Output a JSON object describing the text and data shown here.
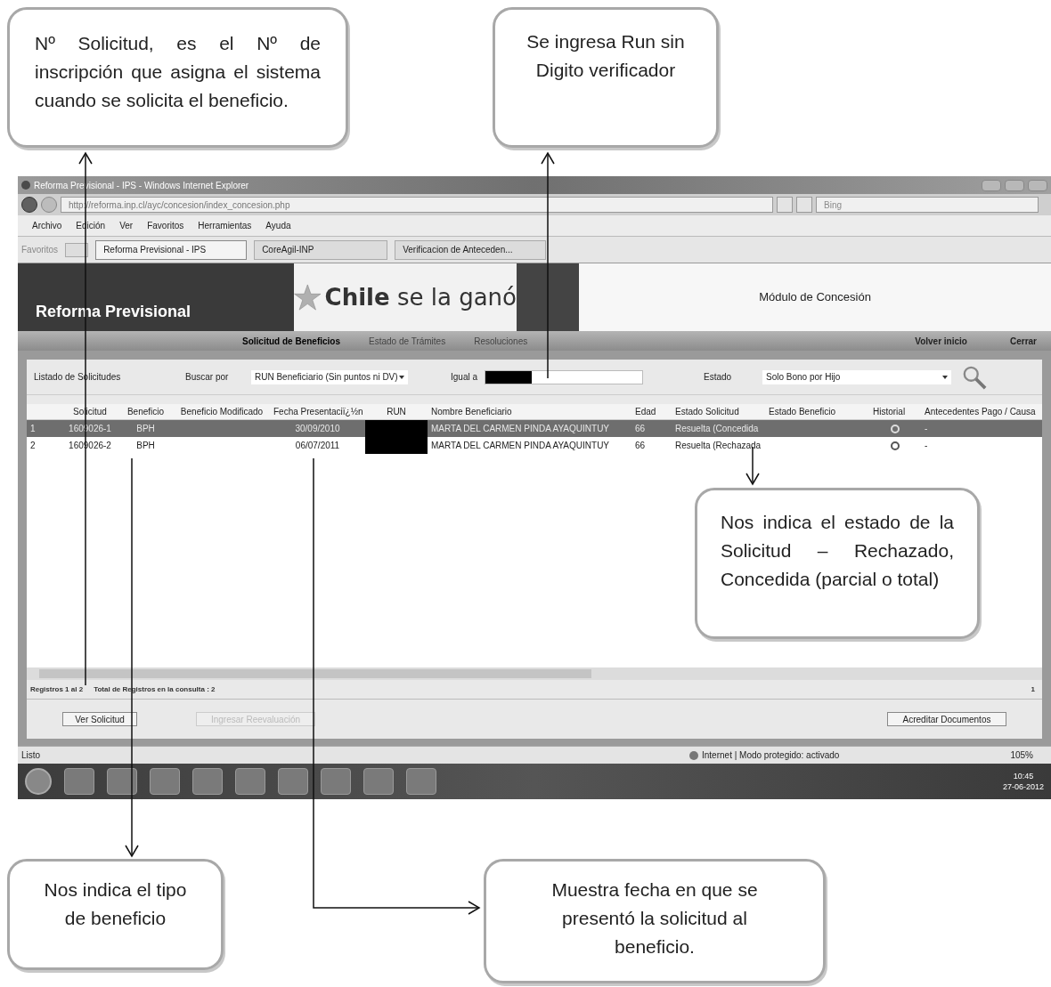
{
  "callouts": [
    {
      "text": "Nº Solicitud, es el Nº de inscripción que asigna el sistema cuando se solicita el beneficio."
    },
    {
      "text": "Se ingresa Run sin Digito verificador"
    },
    {
      "text": "Nos indica el estado de la Solicitud – Rechazado, Concedida (parcial o total)"
    },
    {
      "text": "Nos indica el tipo de beneficio"
    },
    {
      "text": "Muestra fecha en que se presentó la solicitud al beneficio."
    }
  ],
  "window": {
    "title": "Reforma Previsional - IPS - Windows Internet Explorer",
    "address": "http://reforma.inp.cl/ayc/concesion/index_concesion.php",
    "search_placeholder": "Bing",
    "menu": [
      "Archivo",
      "Edición",
      "Ver",
      "Favoritos",
      "Herramientas",
      "Ayuda"
    ],
    "favorites": "Favoritos",
    "tabs": [
      {
        "label": "Reforma Previsional - IPS",
        "selected": true
      },
      {
        "label": "CoreAgil-INP",
        "selected": false
      },
      {
        "label": "Verificacion de Anteceden...",
        "selected": false
      }
    ]
  },
  "banner": {
    "left": "Reforma Previsional",
    "slogan_bold": "Chile",
    "slogan": "se la ganó",
    "module": "Módulo de Concesión"
  },
  "nav": [
    {
      "label": "Solicitud de Beneficios",
      "selected": true
    },
    {
      "label": "Estado de Trámites",
      "selected": false
    },
    {
      "label": "Resoluciones",
      "selected": false
    }
  ],
  "nav_right": [
    "Volver inicio",
    "Cerrar"
  ],
  "filters": {
    "title": "Listado de Solicitudes",
    "search_by_label": "Buscar por",
    "search_by": "RUN Beneficiario (Sin puntos ni DV)",
    "equals_label": "Igual a",
    "state_label": "Estado",
    "state": "Solo Bono por Hijo"
  },
  "table": {
    "columns": [
      {
        "label": "Solicitud",
        "kind": "text"
      },
      {
        "label": "Beneficio",
        "kind": "text"
      },
      {
        "label": "Beneficio Modificado",
        "kind": "text"
      },
      {
        "label": "Fecha Presentaciï¿½n",
        "kind": "text"
      },
      {
        "label": "RUN",
        "kind": "redacted"
      },
      {
        "label": "Nombre Beneficiario",
        "kind": "text"
      },
      {
        "label": "Edad",
        "kind": "text"
      },
      {
        "label": "Estado Solicitud",
        "kind": "text"
      },
      {
        "label": "Estado Beneficio",
        "kind": "text"
      },
      {
        "label": "Historial",
        "kind": "icon"
      },
      {
        "label": "Antecedentes Pago / Causa",
        "kind": "text"
      }
    ],
    "rows": [
      {
        "number": "1",
        "selected": true,
        "cells": [
          "1609026-1",
          "BPH",
          null,
          "30/09/2010",
          null,
          "MARTA DEL CARMEN PINDA AYAQUINTUY",
          "66",
          "Resuelta (Concedida",
          null,
          null,
          "-"
        ]
      },
      {
        "number": "2",
        "selected": false,
        "cells": [
          "1609026-2",
          "BPH",
          null,
          "06/07/2011",
          null,
          "MARTA DEL CARMEN PINDA AYAQUINTUY",
          "66",
          "Resuelta (Rechazada",
          null,
          null,
          "-"
        ]
      }
    ]
  },
  "records": {
    "range": "Registros 1 al 2",
    "total": "Total de Registros en la consulta : 2",
    "page": "1"
  },
  "buttons": [
    {
      "label": "Ver Solicitud",
      "disabled": false
    },
    {
      "label": "Ingresar Reevaluación",
      "disabled": true
    },
    {
      "label": "Acreditar Documentos",
      "disabled": false
    }
  ],
  "status_bar": {
    "text": "Listo",
    "zone": "Internet | Modo protegido: activado",
    "zoom": "105%"
  },
  "taskbar": {
    "time": "10:45",
    "date": "27-06-2012"
  }
}
